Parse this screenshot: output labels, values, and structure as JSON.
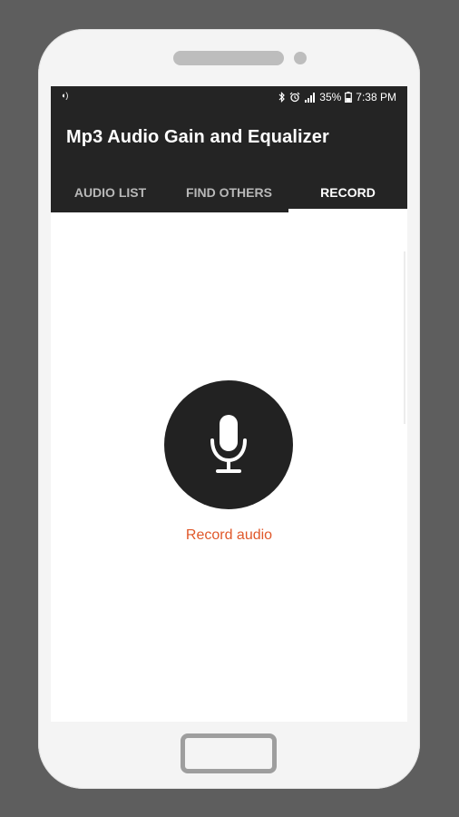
{
  "status_bar": {
    "battery": "35%",
    "time": "7:38 PM"
  },
  "app": {
    "title": "Mp3 Audio Gain and Equalizer"
  },
  "tabs": [
    {
      "label": "AUDIO LIST",
      "active": false
    },
    {
      "label": "FIND OTHERS",
      "active": false
    },
    {
      "label": "RECORD",
      "active": true
    }
  ],
  "record": {
    "label": "Record audio",
    "icon": "microphone-icon"
  },
  "colors": {
    "app_bar": "#242424",
    "accent_text": "#e0582a",
    "record_button": "#222222"
  }
}
